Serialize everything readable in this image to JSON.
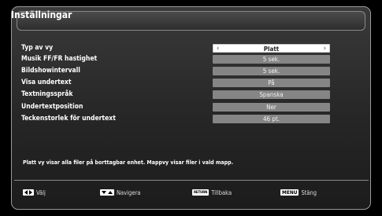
{
  "title": "Inställningar",
  "settings": [
    {
      "label": "Typ av vy",
      "value": "Platt",
      "selected": true
    },
    {
      "label": "Musik FF/FR hastighet",
      "value": "5 sek."
    },
    {
      "label": "Bildshowintervall",
      "value": "5 sek."
    },
    {
      "label": "Visa undertext",
      "value": "På"
    },
    {
      "label": "Textningsspråk",
      "value": "Spanska"
    },
    {
      "label": "Undertextposition",
      "value": "Ner"
    },
    {
      "label": "Teckenstorlek för undertext",
      "value": "46 pt."
    }
  ],
  "info_text": "Platt vy visar alla filer på borttagbar enhet. Mappvy visar filer i vald mapp.",
  "arrows": {
    "left": "‹",
    "right": "›"
  },
  "footer": {
    "select_label": "Välj",
    "navigate_label": "Navigera",
    "back_key": "RETURN",
    "back_label": "Tillbaka",
    "menu_key": "MENU",
    "close_label": "Stäng"
  },
  "colors": {
    "panel": "#2e2e2e",
    "value_bg": "#858585",
    "selected_bg": "#ffffff"
  }
}
